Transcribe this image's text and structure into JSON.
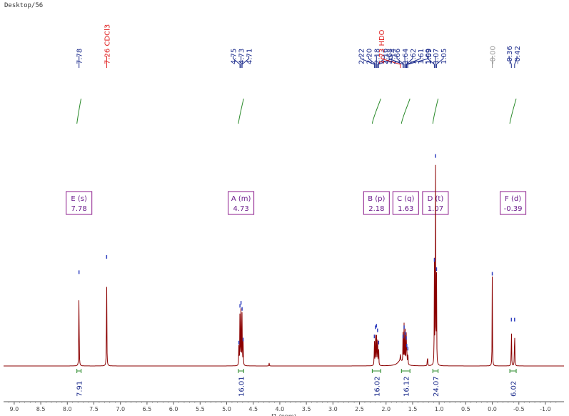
{
  "header": {
    "label": "Desktop/56"
  },
  "chart_data": {
    "type": "line",
    "title": "",
    "xlabel": "f1 (ppm)",
    "ylabel": "",
    "xlim": [
      9.2,
      -1.35
    ],
    "x_reversed": true,
    "x_ticks": [
      "9.0",
      "8.5",
      "8.0",
      "7.5",
      "7.0",
      "6.5",
      "6.0",
      "5.5",
      "5.0",
      "4.5",
      "4.0",
      "3.5",
      "3.0",
      "2.5",
      "2.0",
      "1.5",
      "1.0",
      "0.5",
      "0.0",
      "-0.5",
      "-1.0"
    ],
    "peak_labels": [
      {
        "text": "7.78",
        "ppm": 7.78,
        "color": "#1a2a8b"
      },
      {
        "text": "7.26 CDCl3",
        "ppm": 7.26,
        "color": "#e02020"
      },
      {
        "text": "4.75",
        "ppm": 4.75,
        "color": "#1a2a8b"
      },
      {
        "text": "4.73",
        "ppm": 4.73,
        "color": "#1a2a8b"
      },
      {
        "text": "4.71",
        "ppm": 4.71,
        "color": "#1a2a8b"
      },
      {
        "text": "2.22",
        "ppm": 2.22,
        "color": "#1a2a8b"
      },
      {
        "text": "2.20",
        "ppm": 2.2,
        "color": "#1a2a8b"
      },
      {
        "text": "2.18",
        "ppm": 2.18,
        "color": "#1a2a8b"
      },
      {
        "text": "2.16",
        "ppm": 2.16,
        "color": "#1a2a8b"
      },
      {
        "text": "2.14",
        "ppm": 2.14,
        "color": "#1a2a8b"
      },
      {
        "text": "1.73 HDO",
        "ppm": 1.73,
        "color": "#e02020"
      },
      {
        "text": "1.68",
        "ppm": 1.68,
        "color": "#1a2a8b"
      },
      {
        "text": "1.66",
        "ppm": 1.66,
        "color": "#1a2a8b"
      },
      {
        "text": "1.64",
        "ppm": 1.64,
        "color": "#1a2a8b"
      },
      {
        "text": "1.62",
        "ppm": 1.62,
        "color": "#1a2a8b"
      },
      {
        "text": "1.61",
        "ppm": 1.61,
        "color": "#1a2a8b"
      },
      {
        "text": "1.59",
        "ppm": 1.59,
        "color": "#1a2a8b"
      },
      {
        "text": "1.09",
        "ppm": 1.09,
        "color": "#1a2a8b"
      },
      {
        "text": "1.07",
        "ppm": 1.07,
        "color": "#1a2a8b"
      },
      {
        "text": "1.05",
        "ppm": 1.05,
        "color": "#1a2a8b"
      },
      {
        "text": "-0.00",
        "ppm": 0.0,
        "color": "#999999"
      },
      {
        "text": "-0.36",
        "ppm": -0.36,
        "color": "#1a2a8b"
      },
      {
        "text": "-0.42",
        "ppm": -0.42,
        "color": "#1a2a8b"
      }
    ],
    "multiplets": [
      {
        "letter": "E",
        "type": "s",
        "shift": "7.78",
        "ppm": 7.78
      },
      {
        "letter": "A",
        "type": "m",
        "shift": "4.73",
        "ppm": 4.73
      },
      {
        "letter": "B",
        "type": "p",
        "shift": "2.18",
        "ppm": 2.18
      },
      {
        "letter": "C",
        "type": "q",
        "shift": "1.63",
        "ppm": 1.63
      },
      {
        "letter": "D",
        "type": "t",
        "shift": "1.07",
        "ppm": 1.07
      },
      {
        "letter": "F",
        "type": "d",
        "shift": "-0.39",
        "ppm": -0.39
      }
    ],
    "integrals": [
      {
        "value": "7.91",
        "ppm": 7.78,
        "from": 7.82,
        "to": 7.74
      },
      {
        "value": "16.01",
        "ppm": 4.73,
        "from": 4.78,
        "to": 4.68
      },
      {
        "value": "16.02",
        "ppm": 2.18,
        "from": 2.26,
        "to": 2.1
      },
      {
        "value": "16.12",
        "ppm": 1.63,
        "from": 1.71,
        "to": 1.55
      },
      {
        "value": "24.07",
        "ppm": 1.07,
        "from": 1.12,
        "to": 1.02
      },
      {
        "value": "6.02",
        "ppm": -0.39,
        "from": -0.33,
        "to": -0.45
      }
    ],
    "peaks": [
      {
        "ppm": 7.78,
        "height": 0.62
      },
      {
        "ppm": 7.26,
        "height": 0.72
      },
      {
        "ppm": 4.75,
        "height": 0.4
      },
      {
        "ppm": 4.73,
        "height": 0.42
      },
      {
        "ppm": 4.71,
        "height": 0.38
      },
      {
        "ppm": 4.69,
        "height": 0.18
      },
      {
        "ppm": 4.77,
        "height": 0.16
      },
      {
        "ppm": 4.2,
        "height": 0.02
      },
      {
        "ppm": 2.22,
        "height": 0.2
      },
      {
        "ppm": 2.2,
        "height": 0.26
      },
      {
        "ppm": 2.18,
        "height": 0.27
      },
      {
        "ppm": 2.16,
        "height": 0.24
      },
      {
        "ppm": 2.14,
        "height": 0.16
      },
      {
        "ppm": 1.73,
        "height": 0.06
      },
      {
        "ppm": 1.68,
        "height": 0.2
      },
      {
        "ppm": 1.66,
        "height": 0.26
      },
      {
        "ppm": 1.64,
        "height": 0.22
      },
      {
        "ppm": 1.62,
        "height": 0.19
      },
      {
        "ppm": 1.61,
        "height": 0.14
      },
      {
        "ppm": 1.59,
        "height": 0.12
      },
      {
        "ppm": 1.22,
        "height": 0.09
      },
      {
        "ppm": 1.09,
        "height": 0.7
      },
      {
        "ppm": 1.07,
        "height": 1.38
      },
      {
        "ppm": 1.05,
        "height": 0.64
      },
      {
        "ppm": 0.0,
        "height": 0.61
      },
      {
        "ppm": -0.36,
        "height": 0.31
      },
      {
        "ppm": -0.42,
        "height": 0.31
      }
    ]
  }
}
